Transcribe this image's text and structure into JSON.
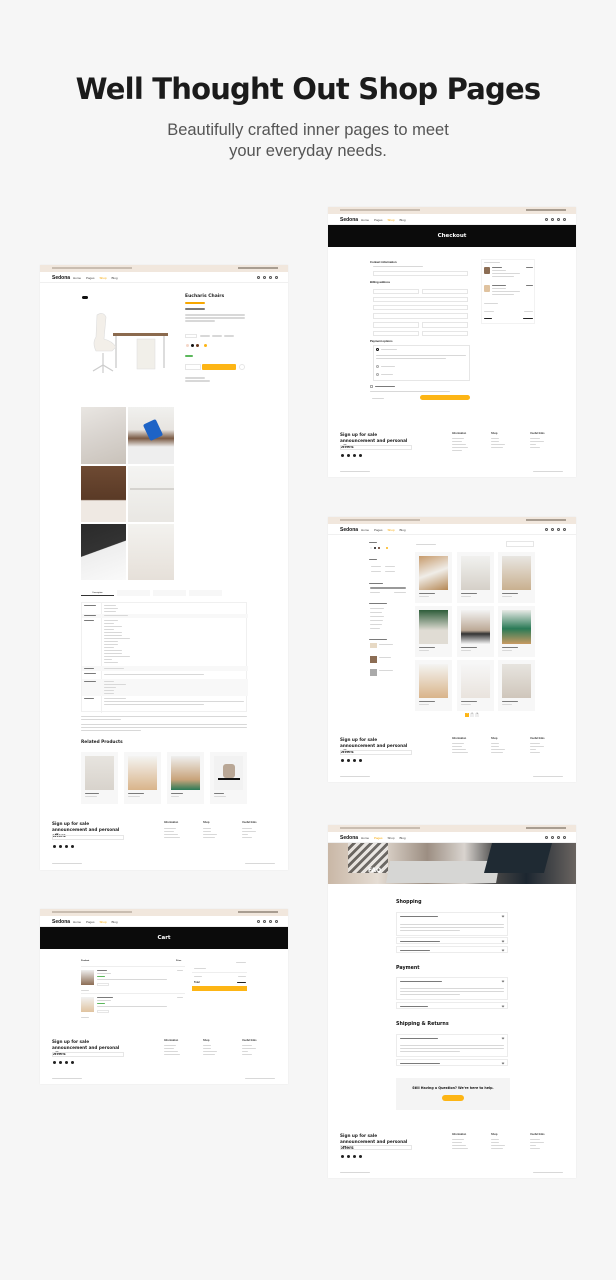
{
  "hero": {
    "title": "Well Thought Out Shop Pages",
    "subtitle_line1": "Beautifully crafted inner pages to meet",
    "subtitle_line2": "your everyday needs."
  },
  "colors": {
    "accent": "#fdb515",
    "topbar": "#f1e7dd",
    "banner": "#0b0b0b",
    "background": "#f6f6f6"
  },
  "common": {
    "logo": "Sedona",
    "nav": [
      "Home",
      "Pages",
      "Shop",
      "Blog"
    ],
    "footer_signup": "Sign up for sale announcement and personal offers",
    "footer_columns": [
      "Information",
      "Shop",
      "Useful links"
    ]
  },
  "product_page": {
    "product_title": "Eucharis Chairs",
    "related_heading": "Related Products",
    "tabs": [
      "Description",
      "",
      "",
      ""
    ],
    "related_products": [
      "",
      "",
      "",
      ""
    ]
  },
  "checkout_page": {
    "banner_title": "Checkout",
    "sections": [
      "Contact information",
      "Billing address",
      "Payment options"
    ]
  },
  "shop_page": {
    "pagination": [
      "1",
      "2",
      "3"
    ],
    "active_page": 1
  },
  "faq_page": {
    "banner_title": "FAQ",
    "sections": [
      {
        "title": "Shopping",
        "questions": 3
      },
      {
        "title": "Payment",
        "questions": 2
      },
      {
        "title": "Shipping & Returns",
        "questions": 2
      }
    ],
    "help_text": "Still Having a Question? We're here to help."
  },
  "cart_page": {
    "banner_title": "Cart",
    "columns": [
      "Product",
      "Price"
    ],
    "summary": [
      "Total"
    ]
  }
}
